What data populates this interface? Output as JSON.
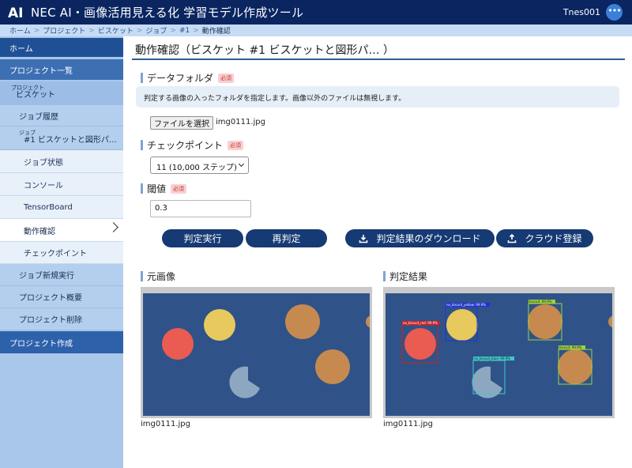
{
  "header": {
    "logo_text": "AI",
    "title": "NEC AI・画像活用見える化 学習モデル作成ツール",
    "user": "Tnes001",
    "menu_icon": "ellipsis-icon"
  },
  "breadcrumb": [
    "ホーム",
    "プロジェクト",
    "ビスケット",
    "ジョブ",
    "#1",
    "動作確認"
  ],
  "sidebar": {
    "home": "ホーム",
    "project_list": "プロジェクト一覧",
    "project_small": "プロジェクト",
    "project_name": "ビスケット",
    "job_history": "ジョブ履歴",
    "job_small": "ジョブ",
    "job_name": "#1 ビスケットと図形パ…",
    "job_status": "ジョブ状態",
    "console": "コンソール",
    "tensorboard": "TensorBoard",
    "verification": "動作確認",
    "checkpoint": "チェックポイント",
    "new_job": "ジョブ新規実行",
    "project_overview": "プロジェクト概要",
    "project_delete": "プロジェクト削除",
    "project_create": "プロジェクト作成"
  },
  "main": {
    "title": "動作確認（ビスケット #1 ビスケットと図形パ… ）",
    "data_folder": {
      "label": "データフォルダ",
      "required": "必須",
      "hint": "判定する画像の入ったフォルダを指定します。画像以外のファイルは無視します。",
      "file_button": "ファイルを選択",
      "file_name": "img0111.jpg"
    },
    "checkpoint": {
      "label": "チェックポイント",
      "required": "必須",
      "selected": "11 (10,000 ステップ)"
    },
    "threshold": {
      "label": "閾値",
      "required": "必須",
      "value": "0.3"
    },
    "buttons": {
      "run": "判定実行",
      "rerun": "再判定",
      "download": "判定結果のダウンロード",
      "cloud": "クラウド登録"
    },
    "original": {
      "label": "元画像",
      "caption": "img0111.jpg"
    },
    "result": {
      "label": "判定結果",
      "caption": "img0111.jpg",
      "detections": [
        {
          "label": "no_biscuit_red: 99.9%",
          "color": "#d02020"
        },
        {
          "label": "no_biscuit_yellow: 99.9%",
          "color": "#2030d8"
        },
        {
          "label": "biscuit: 99.9%",
          "color": "#9fd040"
        },
        {
          "label": "no_biscuit_blue: 99.9%",
          "color": "#40c8c8"
        },
        {
          "label": "biscuit: 99.9%",
          "color": "#9fd040"
        }
      ]
    }
  }
}
